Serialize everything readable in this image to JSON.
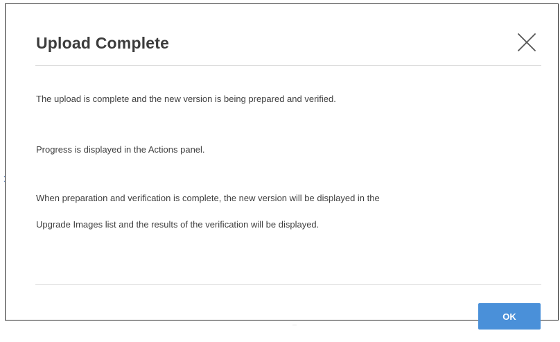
{
  "dialog": {
    "title": "Upload Complete",
    "close_icon": "close-icon",
    "paragraphs": [
      "The upload is complete and the new version is being prepared and verified.",
      "Progress is displayed in the Actions panel.",
      "When preparation and verification is complete, the new version will be displayed in the",
      "Upgrade Images list and the results of the verification will be displayed."
    ],
    "ok_label": "OK"
  },
  "colors": {
    "primary_button": "#4a90d9",
    "title_text": "#3c3c3c",
    "body_text": "#3f3f3f",
    "divider": "#dcdcdc"
  }
}
